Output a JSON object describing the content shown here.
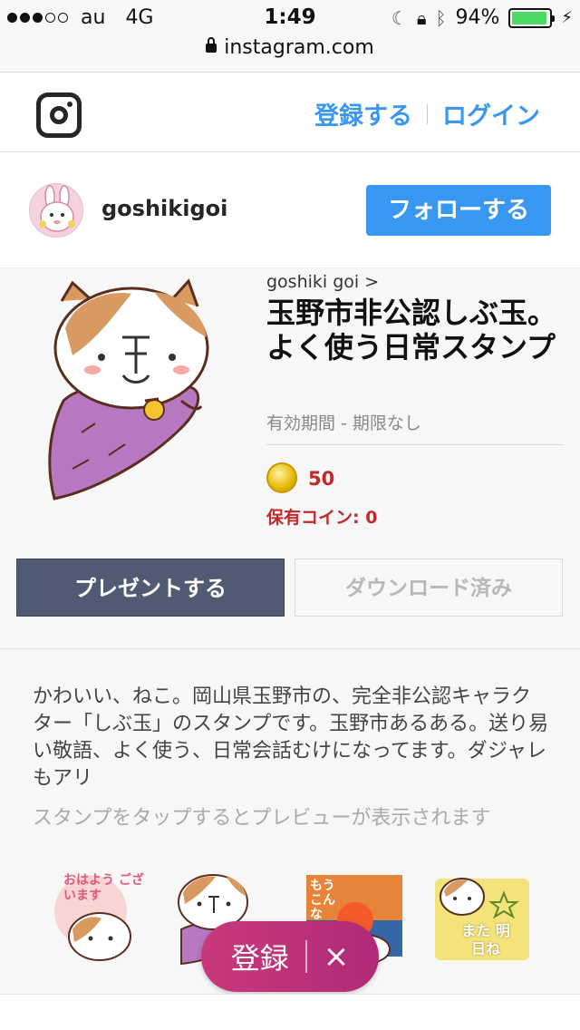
{
  "status_bar": {
    "carrier": "au",
    "network": "4G",
    "time": "1:49",
    "battery": "94%",
    "battery_level": 0.94,
    "icons": [
      "moon-icon",
      "rotation-lock-icon",
      "bluetooth-icon",
      "battery-icon",
      "charging-icon"
    ]
  },
  "url_bar": {
    "domain": "instagram.com"
  },
  "header": {
    "logo": "instagram-logo",
    "signup_label": "登録する",
    "login_label": "ログイン",
    "link_color": "#3897f0"
  },
  "profile": {
    "username": "goshikigoi",
    "follow_label": "フォローする"
  },
  "product": {
    "author": "goshiki goi >",
    "title": "玉野市非公認しぶ玉。よく使う日常スタンプ",
    "validity": "有効期間 - 期限なし",
    "price": "50",
    "owned_coins": "保有コイン: 0",
    "present_label": "プレゼントする",
    "download_label": "ダウンロード済み"
  },
  "description": {
    "text": "かわいい、ねこ。岡山県玉野市の、完全非公認キャラクター「しぶ玉」のスタンプです。玉野市あるある。送り易い敬語、よく使う、日常会話むけになってます。ダジャレもアリ",
    "hint": "スタンプをタップするとプレビューが表示されます"
  },
  "stickers": {
    "sticker1_text": "おはよう ございます",
    "sticker3_text": "もう こんな",
    "sticker4_text": "また 明日ね"
  },
  "floating": {
    "register_label": "登録",
    "close_label": "×",
    "gradient": "#c9397a"
  }
}
